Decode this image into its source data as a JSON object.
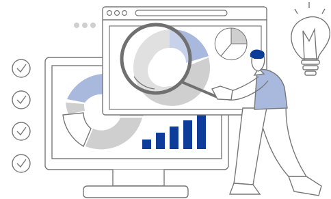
{
  "illustration": {
    "checklist_count": 4,
    "window_dots_count": 3,
    "bar_chart_values": [
      0.3,
      0.5,
      0.68,
      0.86,
      1.0
    ],
    "colors": {
      "outline": "#707070",
      "light_gray": "#cfcfcf",
      "mid_gray": "#bdbdbd",
      "accent_blue": "#a9b9dd",
      "dark_blue": "#0d3d99",
      "background": "#ffffff"
    },
    "icons": [
      "check-circle-icon",
      "lightbulb-icon",
      "magnifying-glass-icon",
      "donut-chart-icon",
      "pie-chart-icon",
      "bar-chart-icon",
      "monitor-icon",
      "browser-window-icon",
      "person-figure"
    ]
  }
}
